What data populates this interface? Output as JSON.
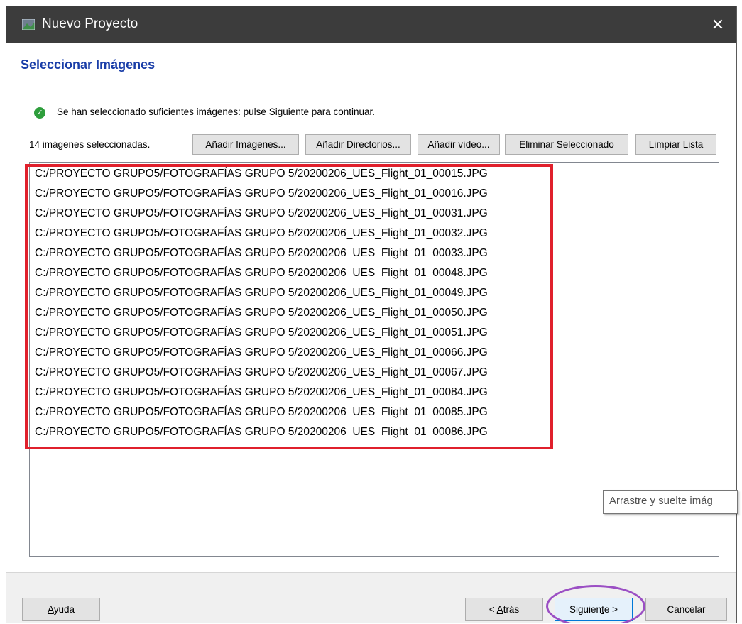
{
  "window": {
    "title": "Nuevo Proyecto",
    "close_glyph": "✕"
  },
  "page": {
    "title": "Seleccionar Imágenes"
  },
  "status": {
    "icon": "check-circle-icon",
    "text": "Se han seleccionado suficientes imágenes: pulse Siguiente para continuar."
  },
  "toolbar": {
    "count_text": "14 imágenes seleccionadas.",
    "add_images_label": "Añadir Imágenes...",
    "add_dirs_label": "Añadir Directorios...",
    "add_video_label": "Añadir vídeo...",
    "remove_selected_label": "Eliminar Seleccionado",
    "clear_list_label": "Limpiar Lista"
  },
  "files": [
    "C:/PROYECTO GRUPO5/FOTOGRAFÍAS GRUPO 5/20200206_UES_Flight_01_00015.JPG",
    "C:/PROYECTO GRUPO5/FOTOGRAFÍAS GRUPO 5/20200206_UES_Flight_01_00016.JPG",
    "C:/PROYECTO GRUPO5/FOTOGRAFÍAS GRUPO 5/20200206_UES_Flight_01_00031.JPG",
    "C:/PROYECTO GRUPO5/FOTOGRAFÍAS GRUPO 5/20200206_UES_Flight_01_00032.JPG",
    "C:/PROYECTO GRUPO5/FOTOGRAFÍAS GRUPO 5/20200206_UES_Flight_01_00033.JPG",
    "C:/PROYECTO GRUPO5/FOTOGRAFÍAS GRUPO 5/20200206_UES_Flight_01_00048.JPG",
    "C:/PROYECTO GRUPO5/FOTOGRAFÍAS GRUPO 5/20200206_UES_Flight_01_00049.JPG",
    "C:/PROYECTO GRUPO5/FOTOGRAFÍAS GRUPO 5/20200206_UES_Flight_01_00050.JPG",
    "C:/PROYECTO GRUPO5/FOTOGRAFÍAS GRUPO 5/20200206_UES_Flight_01_00051.JPG",
    "C:/PROYECTO GRUPO5/FOTOGRAFÍAS GRUPO 5/20200206_UES_Flight_01_00066.JPG",
    "C:/PROYECTO GRUPO5/FOTOGRAFÍAS GRUPO 5/20200206_UES_Flight_01_00067.JPG",
    "C:/PROYECTO GRUPO5/FOTOGRAFÍAS GRUPO 5/20200206_UES_Flight_01_00084.JPG",
    "C:/PROYECTO GRUPO5/FOTOGRAFÍAS GRUPO 5/20200206_UES_Flight_01_00085.JPG",
    "C:/PROYECTO GRUPO5/FOTOGRAFÍAS GRUPO 5/20200206_UES_Flight_01_00086.JPG"
  ],
  "tooltip": {
    "text": "Arrastre y suelte imág"
  },
  "footer": {
    "help_label": "Ayuda",
    "back_label": "< Atrás",
    "next_label": "Siguiente >",
    "cancel_label": "Cancelar"
  },
  "annotations": {
    "highlight_color": "#e0202c",
    "circle_color": "#9b4fc4"
  }
}
